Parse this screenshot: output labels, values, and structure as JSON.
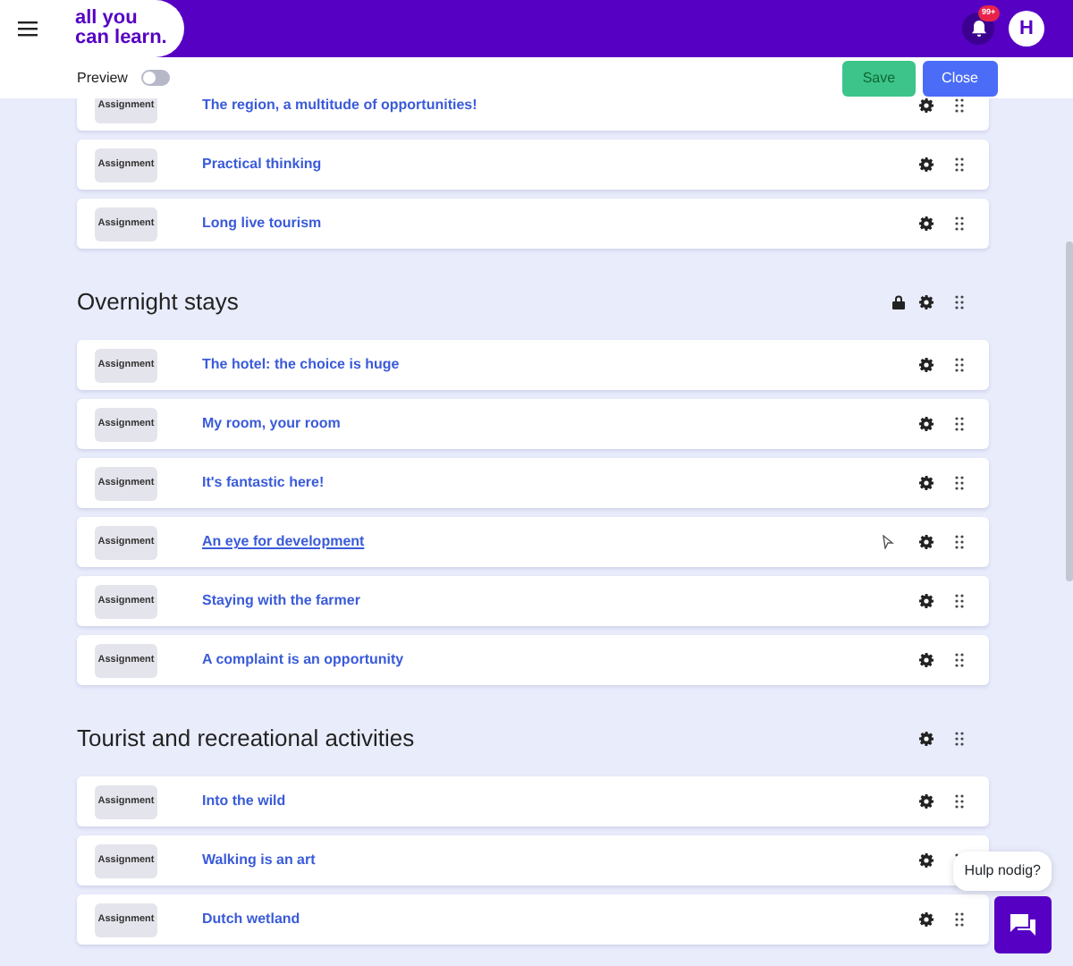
{
  "header": {
    "logo_line_1": "all you",
    "logo_line_2": "can learn.",
    "notification_count": "99+",
    "avatar_initial": "H"
  },
  "toolbar": {
    "preview_label": "Preview",
    "preview_on": false,
    "buttons": [
      {
        "label": "Save",
        "kind": "save"
      },
      {
        "label": "Close",
        "kind": "close"
      }
    ]
  },
  "sections": [
    {
      "items": [
        {
          "type": "Assignment",
          "title": "The region, a multitude of opportunities!",
          "hovered": false
        },
        {
          "type": "Assignment",
          "title": "Practical thinking",
          "hovered": false
        },
        {
          "type": "Assignment",
          "title": "Long live tourism",
          "hovered": false
        }
      ]
    },
    {
      "title": "Overnight stays",
      "locked": true,
      "items": [
        {
          "type": "Assignment",
          "title": "The hotel: the choice is huge",
          "hovered": false
        },
        {
          "type": "Assignment",
          "title": "My room, your room",
          "hovered": false
        },
        {
          "type": "Assignment",
          "title": "It's fantastic here!",
          "hovered": false
        },
        {
          "type": "Assignment",
          "title": "An eye for development",
          "hovered": true
        },
        {
          "type": "Assignment",
          "title": "Staying with the farmer",
          "hovered": false
        },
        {
          "type": "Assignment",
          "title": "A complaint is an opportunity",
          "hovered": false
        }
      ]
    },
    {
      "title": "Tourist and recreational activities",
      "locked": false,
      "items": [
        {
          "type": "Assignment",
          "title": "Into the wild",
          "hovered": false
        },
        {
          "type": "Assignment",
          "title": "Walking is an art",
          "hovered": false
        },
        {
          "type": "Assignment",
          "title": "Dutch wetland",
          "hovered": false
        }
      ]
    }
  ],
  "help": {
    "bubble": "Hulp nodig?"
  }
}
